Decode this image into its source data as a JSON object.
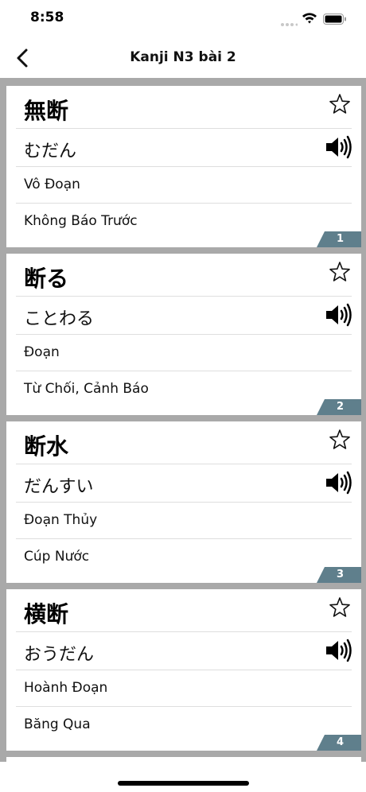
{
  "status_bar": {
    "time": "8:58"
  },
  "nav": {
    "title": "Kanji N3 bài 2",
    "back_icon": "chevron-left-icon"
  },
  "colors": {
    "list_background": "#a9a9a9",
    "badge": "#5f7f8c"
  },
  "cards": [
    {
      "kanji": "無断",
      "kana": "むだん",
      "hanviet": "Vô Đoạn",
      "meaning": "Không Báo Trước",
      "index": "1"
    },
    {
      "kanji": "断る",
      "kana": "ことわる",
      "hanviet": "Đoạn",
      "meaning": "Từ Chối, Cảnh Báo",
      "index": "2"
    },
    {
      "kanji": "断水",
      "kana": "だんすい",
      "hanviet": "Đoạn Thủy",
      "meaning": "Cúp Nước",
      "index": "3"
    },
    {
      "kanji": "横断",
      "kana": "おうだん",
      "hanviet": "Hoành Đoạn",
      "meaning": "Băng Qua",
      "index": "4"
    }
  ]
}
